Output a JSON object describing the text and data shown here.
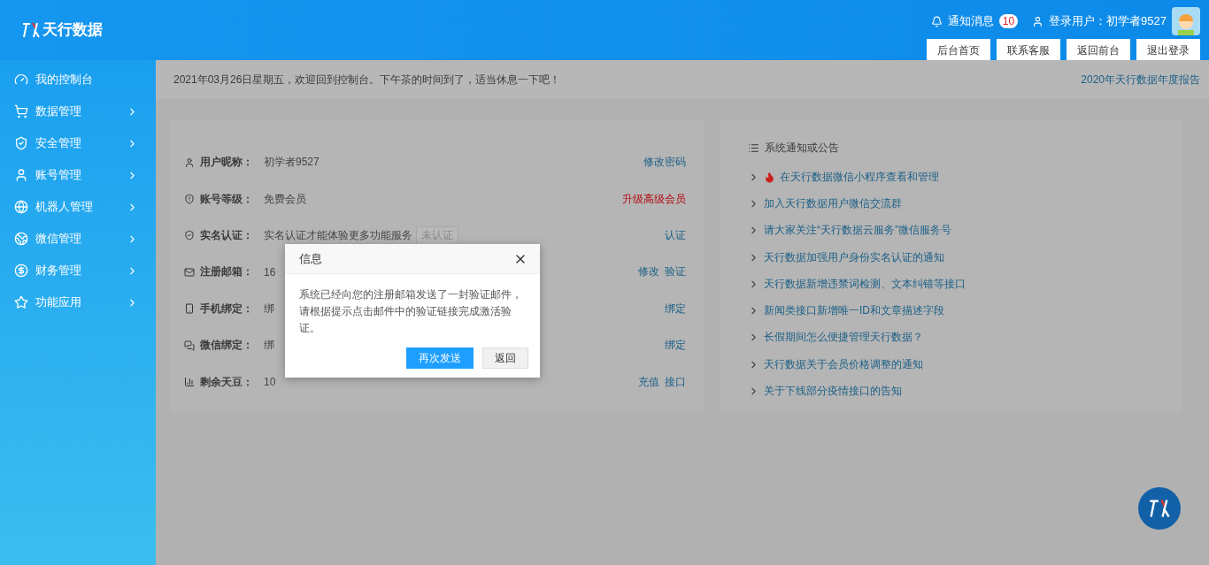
{
  "header": {
    "logo_text": "天行数据",
    "notifications": {
      "label": "通知消息",
      "count": "10"
    },
    "user": {
      "label": "登录用户：初学者9527"
    },
    "buttons": [
      "后台首页",
      "联系客服",
      "返回前台",
      "退出登录"
    ]
  },
  "sidebar": {
    "items": [
      {
        "label": "我的控制台",
        "expandable": false
      },
      {
        "label": "数据管理",
        "expandable": true
      },
      {
        "label": "安全管理",
        "expandable": true
      },
      {
        "label": "账号管理",
        "expandable": true
      },
      {
        "label": "机器人管理",
        "expandable": true
      },
      {
        "label": "微信管理",
        "expandable": true
      },
      {
        "label": "财务管理",
        "expandable": true
      },
      {
        "label": "功能应用",
        "expandable": true
      }
    ]
  },
  "welcome": {
    "text": "2021年03月26日星期五，欢迎回到控制台。下午茶的时间到了，适当休息一下吧！",
    "link": "2020年天行数据年度报告"
  },
  "account": {
    "rows": [
      {
        "label": "用户昵称：",
        "value": "初学者9527",
        "actions": [
          {
            "label": "修改密码",
            "kind": "link"
          }
        ]
      },
      {
        "label": "账号等级：",
        "value": "免费会员",
        "actions": [
          {
            "label": "升级高级会员",
            "kind": "warning"
          }
        ]
      },
      {
        "label": "实名认证：",
        "value": "实名认证才能体验更多功能服务",
        "tag": "未认证",
        "actions": [
          {
            "label": "认证",
            "kind": "link"
          }
        ]
      },
      {
        "label": "注册邮箱：",
        "value": "16",
        "actions": [
          {
            "label": "修改",
            "kind": "link"
          },
          {
            "label": "验证",
            "kind": "link"
          }
        ]
      },
      {
        "label": "手机绑定：",
        "value": "绑",
        "actions": [
          {
            "label": "绑定",
            "kind": "link"
          }
        ]
      },
      {
        "label": "微信绑定：",
        "value": "绑",
        "actions": [
          {
            "label": "绑定",
            "kind": "link"
          }
        ]
      },
      {
        "label": "剩余天豆：",
        "value": "10",
        "actions": [
          {
            "label": "充值",
            "kind": "link"
          },
          {
            "label": "接口",
            "kind": "link"
          }
        ]
      }
    ]
  },
  "notices": {
    "title": "系统通知或公告",
    "items": [
      {
        "text": "在天行数据微信小程序查看和管理",
        "hot": true
      },
      {
        "text": "加入天行数据用户微信交流群",
        "hot": false
      },
      {
        "text": "请大家关注“天行数据云服务”微信服务号",
        "hot": false
      },
      {
        "text": "天行数据加强用户身份实名认证的通知",
        "hot": false
      },
      {
        "text": "天行数据新增违禁词检测、文本纠错等接口",
        "hot": false
      },
      {
        "text": "新闻类接口新增唯一ID和文章描述字段",
        "hot": false
      },
      {
        "text": "长假期间怎么便捷管理天行数据？",
        "hot": false
      },
      {
        "text": "天行数据关于会员价格调整的通知",
        "hot": false
      },
      {
        "text": "关于下线部分疫情接口的告知",
        "hot": false
      }
    ]
  },
  "dialog": {
    "title": "信息",
    "message": "系统已经向您的注册邮箱发送了一封验证邮件，请根据提示点击邮件中的验证链接完成激活验证。",
    "buttons": [
      {
        "label": "再次发送",
        "kind": "primary"
      },
      {
        "label": "返回",
        "kind": "secondary"
      }
    ]
  }
}
